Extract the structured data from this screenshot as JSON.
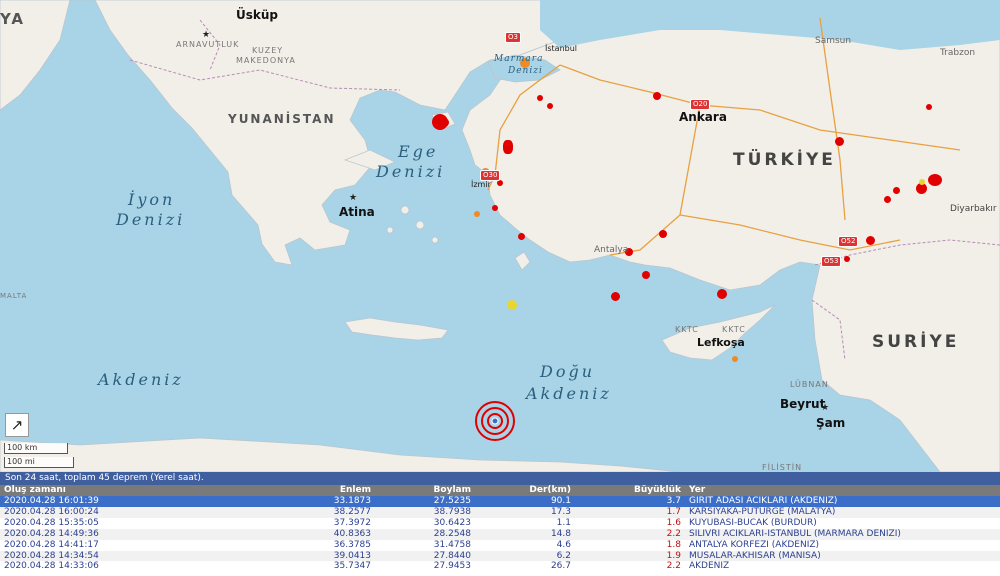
{
  "map": {
    "seas": {
      "ege_1": "Ege",
      "ege_2": "Denizi",
      "iyon_1": "İyon",
      "iyon_2": "Denizi",
      "akdeniz": "Akdeniz",
      "dogu_1": "Doğu",
      "dogu_2": "Akdeniz",
      "marmara_1": "Marmara",
      "marmara_2": "Denizi"
    },
    "countries": {
      "turkiye": "TÜRKİYE",
      "yunanistan": "YUNANİSTAN",
      "suriye": "SURİYE",
      "arnavutluk": "ARNAVUTLUK",
      "kuzey_1": "KUZEY",
      "kuzey_2": "MAKEDONYA",
      "lubnan": "LÜBNAN",
      "kktc": "KKTC",
      "filistin": "FİLİSTİN",
      "ya": "YA",
      "malta": "MALTA"
    },
    "cities": {
      "uskup": "Üsküp",
      "atina": "Atina",
      "ankara": "Ankara",
      "istanbul": "İstanbul",
      "izmir": "İzmir",
      "samsun": "Samsun",
      "trabzon": "Trabzon",
      "antalya": "Antalya",
      "diyarbakir": "Diyarbakır",
      "lefkosa": "Lefkoşa",
      "beyrut": "Beyrut",
      "sam": "Şam"
    },
    "roads": [
      "O3",
      "O20",
      "O30",
      "O52",
      "O53"
    ],
    "scale": {
      "km": "100 km",
      "mi": "100 mi"
    },
    "highlighted_event": {
      "lat": 33.1873,
      "lon": 27.5235,
      "mag": 3.7
    },
    "colors": {
      "sea": "#a9d3e6",
      "land": "#f2efe9",
      "recent": "#e00000",
      "older": "#f08a24",
      "oldest": "#e8d630"
    }
  },
  "panel": {
    "status": "Son 24 saat, toplam 45 deprem (Yerel saat).",
    "columns": {
      "time": "Oluş zamanı",
      "lat": "Enlem",
      "lon": "Boylam",
      "depth": "Der(km)",
      "mag": "Büyüklük",
      "place": "Yer"
    },
    "rows": [
      {
        "time": "2020.04.28 16:01:39",
        "lat": "33.1873",
        "lon": "27.5235",
        "depth": "90.1",
        "mag": "3.7",
        "place": "GIRIT ADASI ACIKLARI (AKDENIZ)"
      },
      {
        "time": "2020.04.28 16:00:24",
        "lat": "38.2577",
        "lon": "38.7938",
        "depth": "17.3",
        "mag": "1.7",
        "place": "KARSIYAKA-PUTURGE (MALATYA)"
      },
      {
        "time": "2020.04.28 15:35:05",
        "lat": "37.3972",
        "lon": "30.6423",
        "depth": "1.1",
        "mag": "1.6",
        "place": "KUYUBASI-BUCAK (BURDUR)"
      },
      {
        "time": "2020.04.28 14:49:36",
        "lat": "40.8363",
        "lon": "28.2548",
        "depth": "14.8",
        "mag": "2.2",
        "place": "SILIVRI ACIKLARI-ISTANBUL (MARMARA DENIZI)"
      },
      {
        "time": "2020.04.28 14:41:17",
        "lat": "36.3785",
        "lon": "31.4758",
        "depth": "4.6",
        "mag": "1.8",
        "place": "ANTALYA KORFEZI (AKDENIZ)"
      },
      {
        "time": "2020.04.28 14:34:54",
        "lat": "39.0413",
        "lon": "27.8440",
        "depth": "6.2",
        "mag": "1.9",
        "place": "MUSALAR-AKHISAR (MANISA)"
      },
      {
        "time": "2020.04.28 14:33:06",
        "lat": "35.7347",
        "lon": "27.9453",
        "depth": "26.7",
        "mag": "2.2",
        "place": "AKDENIZ"
      }
    ]
  }
}
